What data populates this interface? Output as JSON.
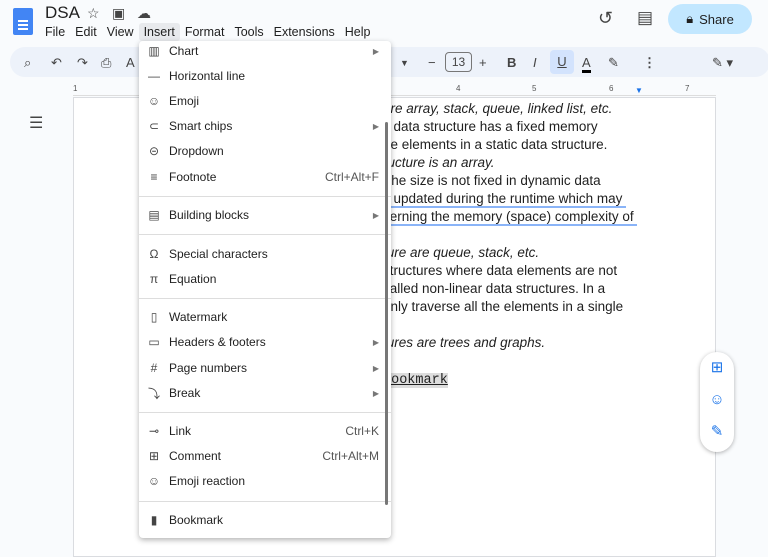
{
  "app": {
    "title": "DSA",
    "menus": [
      "File",
      "Edit",
      "View",
      "Insert",
      "Format",
      "Tools",
      "Extensions",
      "Help"
    ],
    "share_label": "Share"
  },
  "toolbar": {
    "font_size": "13"
  },
  "ruler": {
    "labels": [
      "1",
      "4",
      "5",
      "6",
      "7"
    ]
  },
  "document": {
    "lines": [
      {
        "text": "are array, stack, queue, linked list, etc.",
        "style": "it"
      },
      {
        "text": "c data structure has a fixed memory",
        "style": ""
      },
      {
        "text": "ne elements in a static data structure.",
        "style": ""
      },
      {
        "text": "ructure is an array.",
        "style": "it"
      },
      {
        "text": "The size is not fixed in dynamic data",
        "style": ""
      },
      {
        "text": "y updated during the runtime which may ",
        "style": "ul"
      },
      {
        "text": "cerning the memory (space) complexity of ",
        "style": "ul"
      },
      {
        "text": "",
        "style": ""
      },
      {
        "text": "ture are queue, stack, etc.",
        "style": "it"
      },
      {
        "text": "structures where data elements are not",
        "style": ""
      },
      {
        "text": "called non-linear data structures. In a",
        "style": ""
      },
      {
        "text": "only traverse all the elements in a single",
        "style": ""
      },
      {
        "text": "",
        "style": ""
      },
      {
        "text": "tures are trees and graphs.",
        "style": "it"
      },
      {
        "text": "",
        "style": ""
      },
      {
        "text": "Bookmark",
        "style": "bm"
      }
    ]
  },
  "insert_menu": {
    "items": [
      {
        "label": "Chart",
        "icon": "chart-icon",
        "submenu": true
      },
      {
        "label": "Horizontal line",
        "icon": "horizontal-line-icon"
      },
      {
        "label": "Emoji",
        "icon": "emoji-icon"
      },
      {
        "label": "Smart chips",
        "icon": "smart-chips-icon",
        "submenu": true
      },
      {
        "label": "Dropdown",
        "icon": "dropdown-icon"
      },
      {
        "label": "Footnote",
        "icon": "footnote-icon",
        "shortcut": "Ctrl+Alt+F"
      },
      {
        "label": "Building blocks",
        "icon": "building-blocks-icon",
        "submenu": true
      },
      {
        "label": "Special characters",
        "icon": "omega-icon"
      },
      {
        "label": "Equation",
        "icon": "pi-icon"
      },
      {
        "label": "Watermark",
        "icon": "watermark-icon"
      },
      {
        "label": "Headers & footers",
        "icon": "headers-footers-icon",
        "submenu": true
      },
      {
        "label": "Page numbers",
        "icon": "hash-icon",
        "submenu": true
      },
      {
        "label": "Break",
        "icon": "break-icon",
        "submenu": true
      },
      {
        "label": "Link",
        "icon": "link-icon",
        "shortcut": "Ctrl+K"
      },
      {
        "label": "Comment",
        "icon": "comment-icon",
        "shortcut": "Ctrl+Alt+M"
      },
      {
        "label": "Emoji reaction",
        "icon": "emoji-reaction-icon"
      },
      {
        "label": "Bookmark",
        "icon": "bookmark-icon"
      }
    ]
  }
}
